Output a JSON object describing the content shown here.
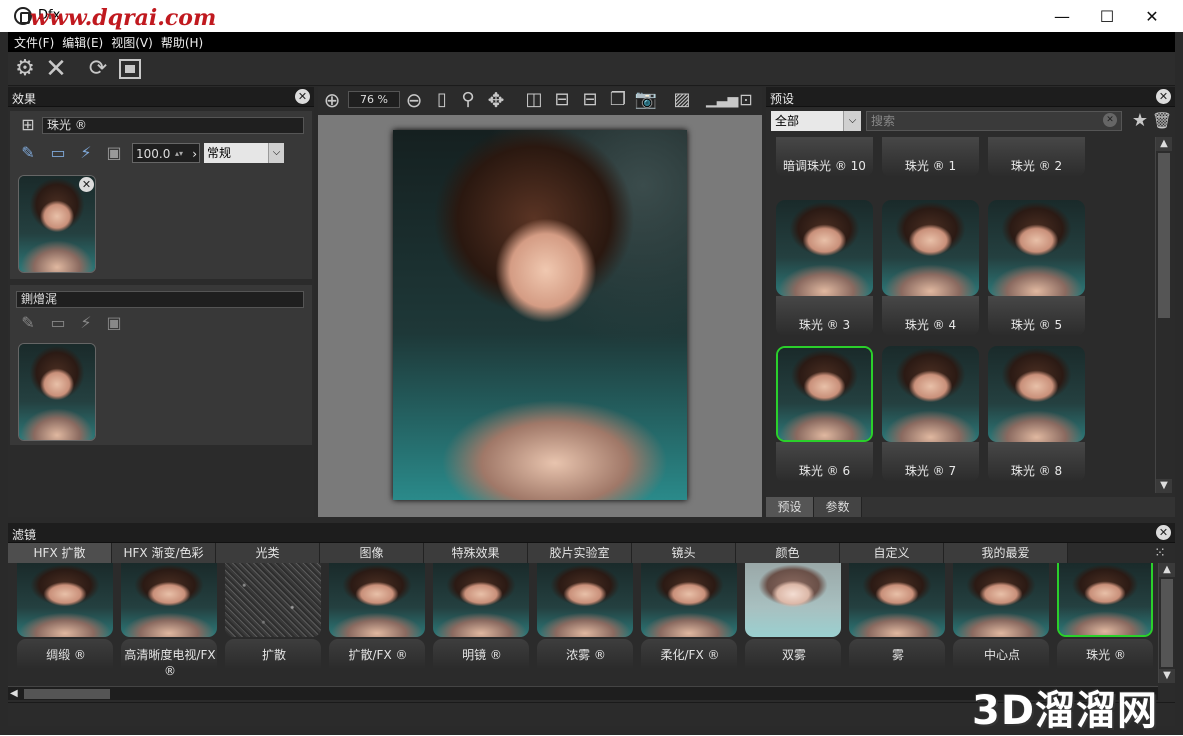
{
  "window": {
    "title": "Dfx",
    "watermark": "www.dqrai.com",
    "minimize": "—",
    "maximize": "☐",
    "close": "✕"
  },
  "menu": [
    "文件(F)",
    "编辑(E)",
    "视图(V)",
    "帮助(H)"
  ],
  "effects": {
    "title": "效果",
    "layer1": {
      "name": "珠光 ®",
      "opacity": "100.0",
      "blend": "常规"
    },
    "layer2": {
      "name": "鍘熷浘"
    }
  },
  "preview": {
    "zoom": "76 %"
  },
  "presets": {
    "title": "预设",
    "category": "全部",
    "search_placeholder": "搜索",
    "items": [
      {
        "label": "暗调珠光 ® 10"
      },
      {
        "label": "珠光 ® 1"
      },
      {
        "label": "珠光 ® 2"
      },
      {
        "label": "珠光 ® 3"
      },
      {
        "label": "珠光 ® 4"
      },
      {
        "label": "珠光 ® 5"
      },
      {
        "label": "珠光 ® 6"
      },
      {
        "label": "珠光 ® 7"
      },
      {
        "label": "珠光 ® 8"
      }
    ],
    "selected_index": 6,
    "tabs": [
      "预设",
      "参数"
    ]
  },
  "filters": {
    "title": "滤镜",
    "tabs": [
      "HFX 扩散",
      "HFX 渐变/色彩",
      "光类",
      "图像",
      "特殊效果",
      "胶片实验室",
      "镜头",
      "颜色",
      "自定义",
      "我的最爱"
    ],
    "items": [
      {
        "label": "绸缎 ®"
      },
      {
        "label": "高清晰度电视/FX ®"
      },
      {
        "label": "扩散"
      },
      {
        "label": "扩散/FX ®"
      },
      {
        "label": "明镜 ®"
      },
      {
        "label": "浓雾 ®"
      },
      {
        "label": "柔化/FX ®"
      },
      {
        "label": "双雾"
      },
      {
        "label": "雾"
      },
      {
        "label": "中心点"
      },
      {
        "label": "珠光 ®"
      }
    ]
  },
  "branding": {
    "logo": "3D溜溜网"
  }
}
